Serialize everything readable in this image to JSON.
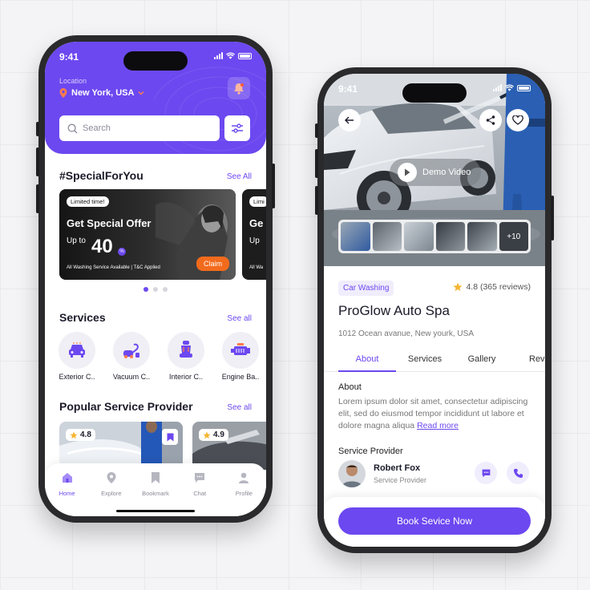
{
  "colors": {
    "accent": "#6c48f0",
    "claim": "#f26b1d",
    "star": "#f5b431"
  },
  "left": {
    "status_time": "9:41",
    "location_label": "Location",
    "location_value": "New York, USA",
    "search_placeholder": "Search",
    "special_title": "#SpecialForYou",
    "special_see_all": "See All",
    "offer": {
      "badge": "Limited time!",
      "title": "Get Special Offer",
      "up_to": "Up to",
      "amount": "40",
      "note": "All Washing Service Available | T&C Applied",
      "claim": "Claim"
    },
    "offer2": {
      "badge": "Limi",
      "title": "Ge",
      "up_to": "Up",
      "note": "All Wa"
    },
    "pagination": {
      "count": 3,
      "active": 0
    },
    "services_title": "Services",
    "services_see_all": "See all",
    "services": [
      {
        "label": "Exterior C..",
        "icon": "car-front-icon"
      },
      {
        "label": "Vacuum C..",
        "icon": "vacuum-icon"
      },
      {
        "label": "Interior C..",
        "icon": "car-seat-icon"
      },
      {
        "label": "Engine Ba..",
        "icon": "engine-icon"
      }
    ],
    "popular_title": "Popular Service Provider",
    "popular_see_all": "See all",
    "providers": [
      {
        "rating": "4.8"
      },
      {
        "rating": "4.9"
      }
    ],
    "nav": [
      {
        "label": "Home",
        "icon": "home-icon",
        "active": true
      },
      {
        "label": "Explore",
        "icon": "compass-icon",
        "active": false
      },
      {
        "label": "Bookmark",
        "icon": "bookmark-icon",
        "active": false
      },
      {
        "label": "Chat",
        "icon": "chat-icon",
        "active": false
      },
      {
        "label": "Profile",
        "icon": "profile-icon",
        "active": false
      }
    ]
  },
  "right": {
    "status_time": "9:41",
    "demo_label": "Demo Video",
    "gallery_more": "+10",
    "category": "Car Washing",
    "rating": "4.8 (365 reviews)",
    "name": "ProGlow Auto Spa",
    "address": "1012 Ocean avanue, New yourk, USA",
    "tabs": [
      "About",
      "Services",
      "Gallery",
      "Rev"
    ],
    "active_tab": 0,
    "about_title": "About",
    "about_text": "Lorem ipsum dolor sit amet, consectetur adipiscing elit, sed do eiusmod tempor incididunt ut labore et dolore magna aliqua",
    "read_more": "Read more",
    "provider_title": "Service Provider",
    "provider_name": "Robert Fox",
    "provider_role": "Service Provider",
    "cta": "Book Sevice Now"
  }
}
